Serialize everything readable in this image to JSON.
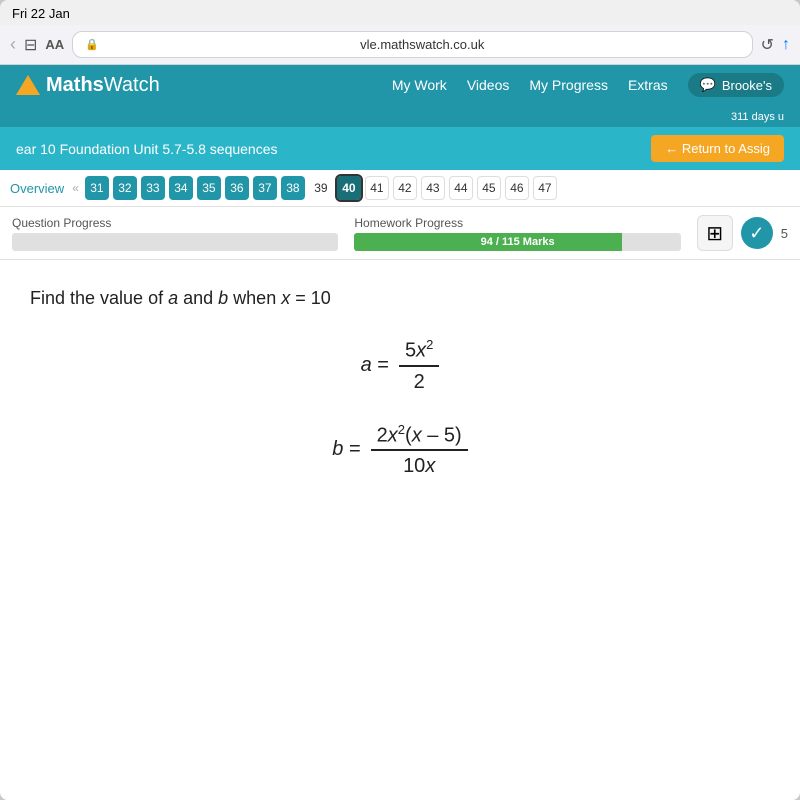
{
  "status_bar": {
    "date": "Fri 22 Jan"
  },
  "browser": {
    "url": "vle.mathswatch.co.uk",
    "aa_label": "AA",
    "back_icon": "‹",
    "bookmarks_icon": "□",
    "reload_icon": "↺",
    "share_icon": "↑"
  },
  "header": {
    "logo_text_maths": "Maths",
    "logo_text_watch": "Watch",
    "nav_items": [
      "My Work",
      "Videos",
      "My Progress",
      "Extras"
    ],
    "user_label": "Brooke's",
    "days_label": "311 days u"
  },
  "assignment_bar": {
    "title": "ear 10 Foundation Unit 5.7-5.8 sequences",
    "return_btn": "← Return to Assig"
  },
  "tab_nav": {
    "overview_label": "Overview",
    "arrow_label": "«",
    "tabs_green": [
      "31",
      "32",
      "33",
      "34",
      "35",
      "36",
      "37",
      "38"
    ],
    "tab_plain_39": "39",
    "tab_active_40": "40",
    "tabs_plain": [
      "41",
      "42",
      "43",
      "44",
      "45",
      "46",
      "47"
    ]
  },
  "progress": {
    "question_label": "Question Progress",
    "question_value": 0,
    "homework_label": "Homework Progress",
    "homework_marks": "94 / 115 Marks",
    "homework_pct": 82,
    "calc_icon": "⊞",
    "check_icon": "✓",
    "num_badge": "5"
  },
  "question": {
    "text": "Find the value of a and b when x = 10",
    "eq_a_lhs": "a =",
    "eq_a_numerator": "5x²",
    "eq_a_denominator": "2",
    "eq_b_lhs": "b =",
    "eq_b_numerator": "2x²(x – 5)",
    "eq_b_denominator": "10x"
  }
}
